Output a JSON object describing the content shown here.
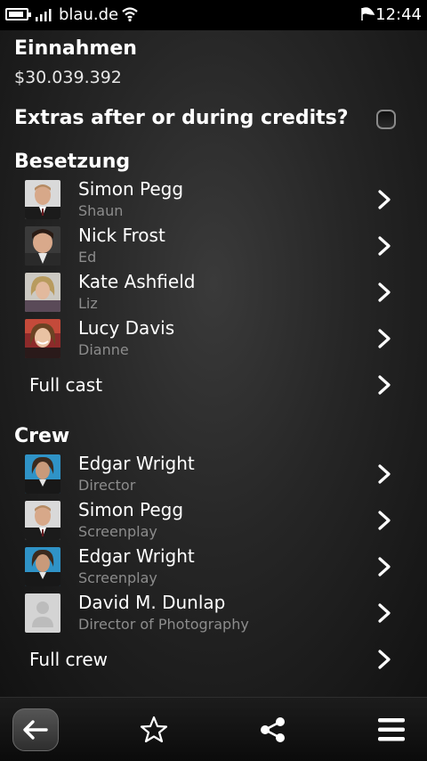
{
  "status_bar": {
    "carrier": "blau.de",
    "time": "12:44",
    "battery_level": 0.75,
    "icons": [
      "battery-icon",
      "signal-icon",
      "wifi-icon",
      "notification-flag-icon"
    ]
  },
  "revenue": {
    "label": "Einnahmen",
    "value": "$30.039.392"
  },
  "extras": {
    "label": "Extras after or during credits?",
    "checked": false
  },
  "cast": {
    "title": "Besetzung",
    "members": [
      {
        "name": "Simon Pegg",
        "role": "Shaun"
      },
      {
        "name": "Nick Frost",
        "role": "Ed"
      },
      {
        "name": "Kate Ashfield",
        "role": "Liz"
      },
      {
        "name": "Lucy Davis",
        "role": "Dianne"
      }
    ],
    "more_label": "Full cast"
  },
  "crew": {
    "title": "Crew",
    "members": [
      {
        "name": "Edgar Wright",
        "role": "Director"
      },
      {
        "name": "Simon Pegg",
        "role": "Screenplay"
      },
      {
        "name": "Edgar Wright",
        "role": "Screenplay"
      },
      {
        "name": "David M. Dunlap",
        "role": "Director of Photography"
      }
    ],
    "more_label": "Full crew"
  },
  "toolbar": {
    "icons": [
      "back-arrow-icon",
      "star-icon",
      "share-icon",
      "menu-icon"
    ]
  }
}
